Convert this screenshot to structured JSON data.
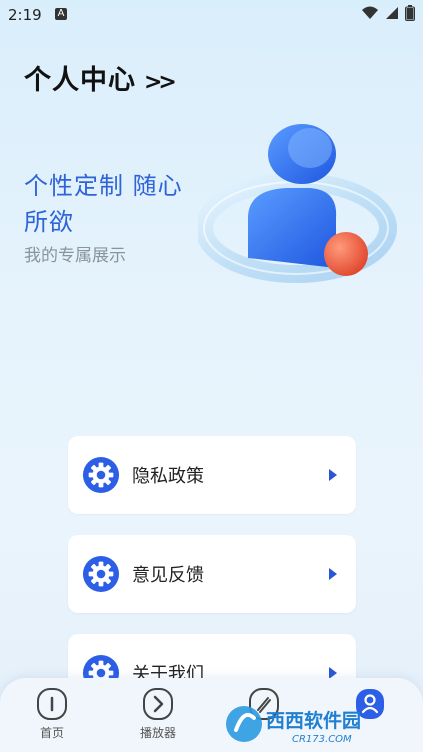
{
  "status_bar": {
    "time": "2:19",
    "notification_letter": "A"
  },
  "header": {
    "title": "个人中心",
    "chevrons": ">>"
  },
  "hero": {
    "line1": "个性定制 随心",
    "line2": "所欲",
    "subtitle": "我的专属展示"
  },
  "menu": [
    {
      "label": "隐私政策",
      "icon": "gear-icon"
    },
    {
      "label": "意见反馈",
      "icon": "gear-icon"
    },
    {
      "label": "关于我们",
      "icon": "gear-icon"
    }
  ],
  "tabs": [
    {
      "label": "首页",
      "icon": "info-icon"
    },
    {
      "label": "播放器",
      "icon": "chevron-right-circle-icon"
    },
    {
      "label": "",
      "icon": "brush-icon"
    },
    {
      "label": "",
      "icon": "profile-icon"
    }
  ],
  "watermark": {
    "text": "西西软件园",
    "url": "CR173.COM"
  },
  "colors": {
    "accent": "#2f64d8",
    "icon_blue": "#2c5fe6",
    "arrow_blue": "#2b55d6"
  }
}
